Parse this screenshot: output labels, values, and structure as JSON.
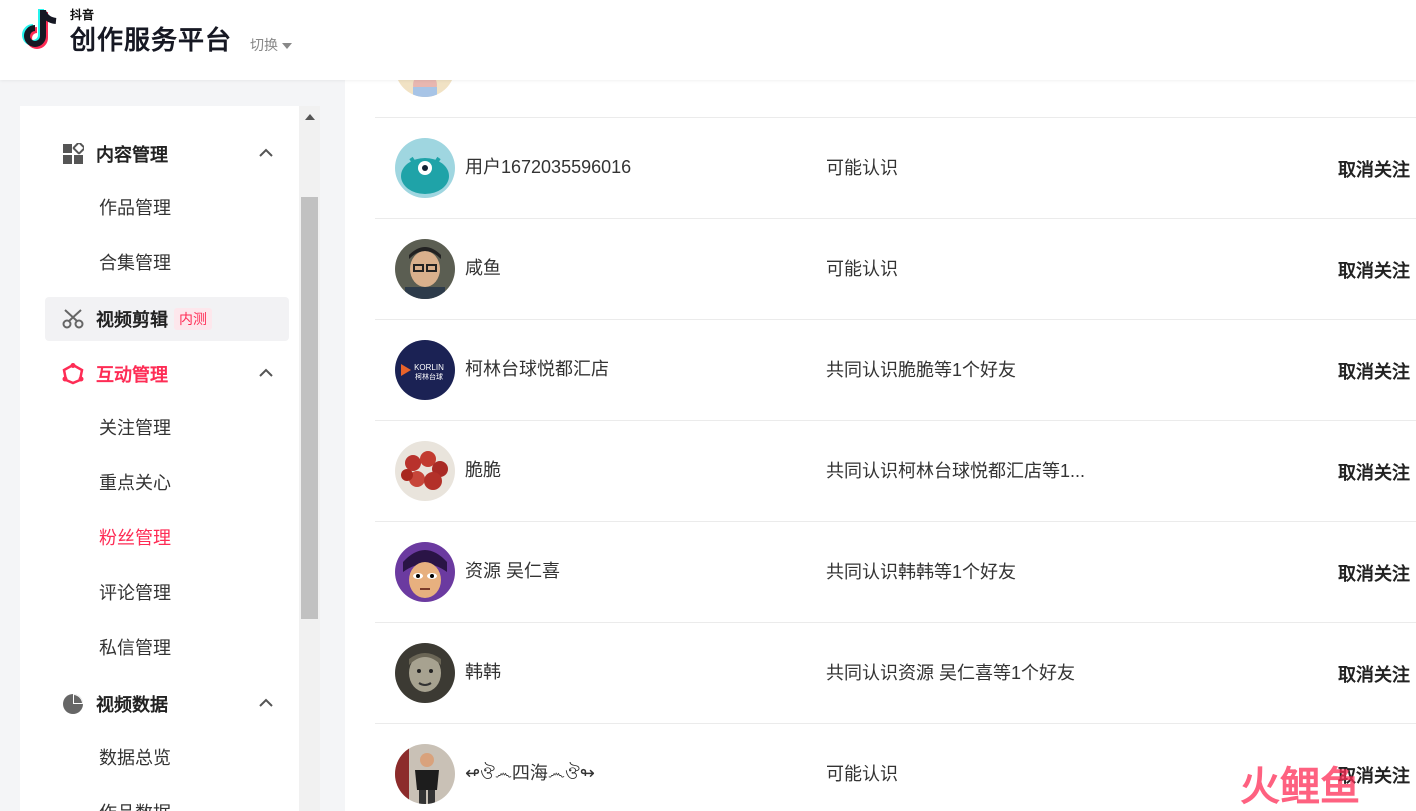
{
  "header": {
    "brand_small": "抖音",
    "brand_title": "创作服务平台",
    "switch_label": "切换"
  },
  "sidebar": {
    "groups": [
      {
        "label": "内容管理",
        "icon": "grid-icon",
        "expanded": true,
        "items": [
          {
            "label": "作品管理"
          },
          {
            "label": "合集管理"
          }
        ]
      },
      {
        "label": "视频剪辑",
        "icon": "scissors-icon",
        "badge": "内测",
        "highlighted": true
      },
      {
        "label": "互动管理",
        "icon": "interaction-icon",
        "expanded": true,
        "active": true,
        "items": [
          {
            "label": "关注管理"
          },
          {
            "label": "重点关心"
          },
          {
            "label": "粉丝管理",
            "active": true
          },
          {
            "label": "评论管理"
          },
          {
            "label": "私信管理"
          }
        ]
      },
      {
        "label": "视频数据",
        "icon": "pie-chart-icon",
        "expanded": true,
        "items": [
          {
            "label": "数据总览"
          },
          {
            "label": "作品数据"
          }
        ]
      }
    ]
  },
  "follow_list": {
    "unfollow_label": "取消关注",
    "rows": [
      {
        "name": "用户1672035596016",
        "relation": "可能认识",
        "avatar": "teal-monster-avatar"
      },
      {
        "name": "咸鱼",
        "relation": "可能认识",
        "avatar": "man-glasses-avatar"
      },
      {
        "name": "柯林台球悦都汇店",
        "relation": "共同认识脆脆等1个好友",
        "avatar": "korlin-logo-avatar",
        "avatar_text": "KORLIN",
        "avatar_subtext": "柯林台球"
      },
      {
        "name": "脆脆",
        "relation": "共同认识柯林台球悦都汇店等1...",
        "avatar": "red-berries-avatar"
      },
      {
        "name": "资源 吴仁喜",
        "relation": "共同认识韩韩等1个好友",
        "avatar": "cartoon-face-avatar"
      },
      {
        "name": "韩韩",
        "relation": "共同认识资源 吴仁喜等1个好友",
        "avatar": "man-portrait-avatar"
      },
      {
        "name": "↫ঔ෴四海෴ঔ↬",
        "relation": "可能认识",
        "avatar": "person-standing-avatar"
      }
    ]
  },
  "watermark": {
    "text": "火鲤鱼"
  },
  "colors": {
    "accent": "#fe2c55",
    "sidebar_bg": "#ffffff",
    "page_bg": "#f4f5f7"
  }
}
